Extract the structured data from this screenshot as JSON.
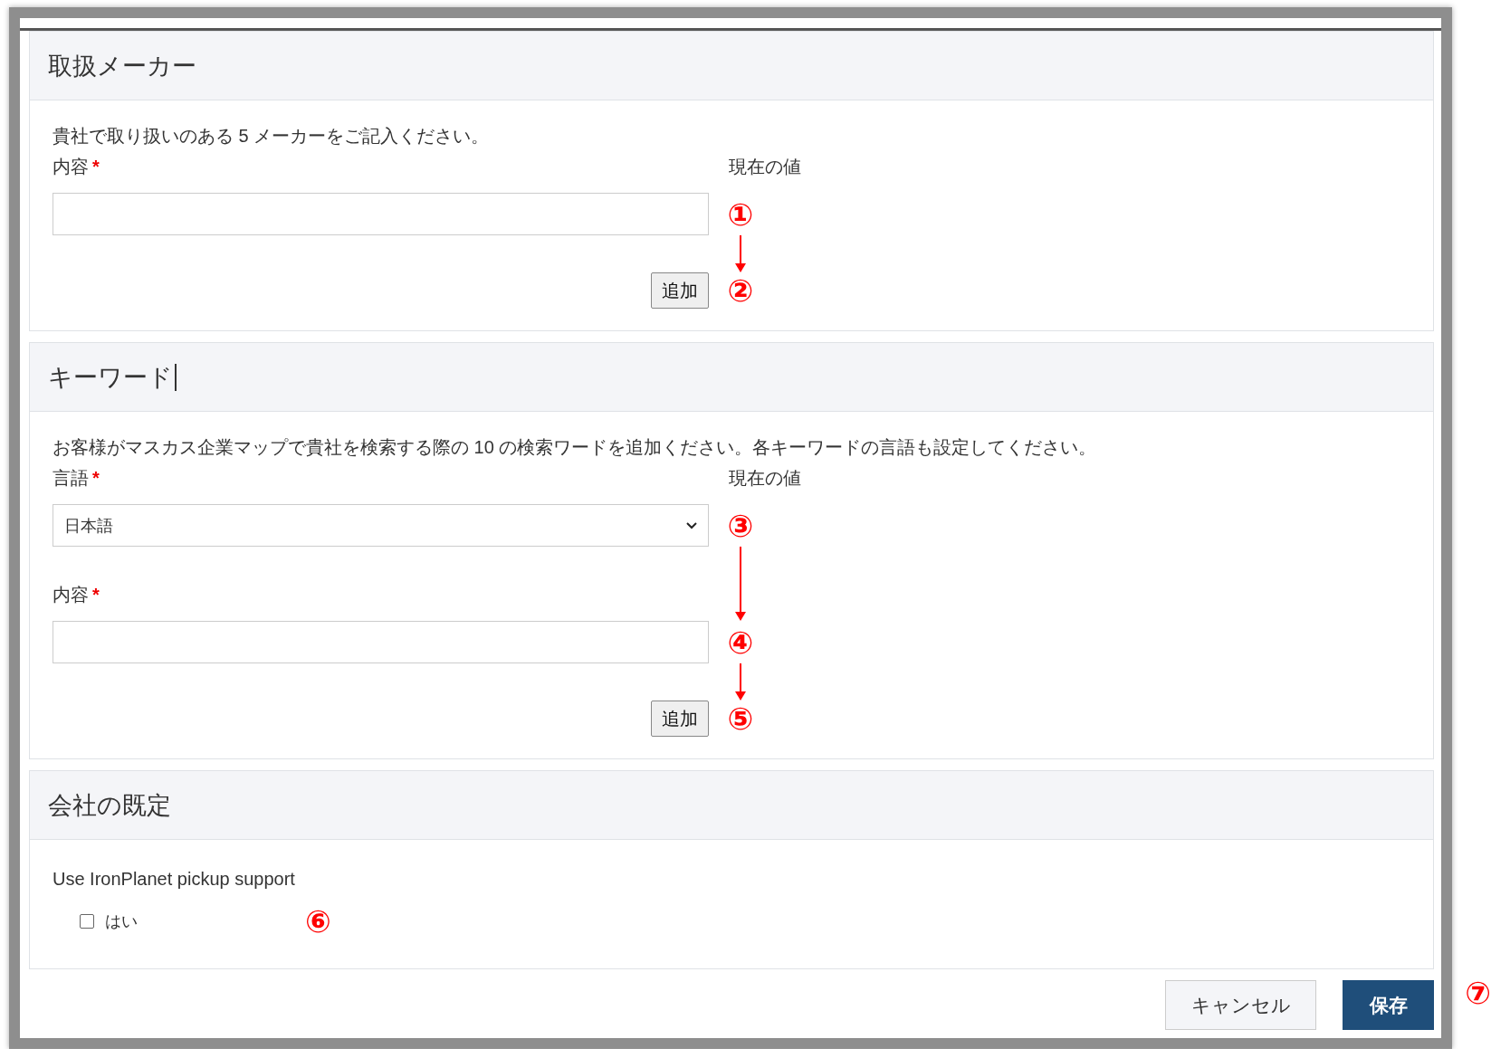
{
  "sections": [
    {
      "title": "取扱メーカー",
      "text_cursor": false,
      "description": "貴社で取り扱いのある 5 メーカーをご記入ください。",
      "current_value_label": "現在の値",
      "fields": [
        {
          "kind": "text",
          "label": "内容",
          "required_mark": "*",
          "marker": "①"
        }
      ],
      "add_button": {
        "label": "追加",
        "marker": "②",
        "arrow_before": true
      }
    },
    {
      "title": "キーワード",
      "text_cursor": true,
      "description": "お客様がマスカス企業マップで貴社を検索する際の 10 の検索ワードを追加ください。各キーワードの言語も設定してください。",
      "current_value_label": "現在の値",
      "fields": [
        {
          "kind": "select",
          "label": "言語",
          "required_mark": "*",
          "value": "日本語",
          "marker": "③"
        },
        {
          "kind": "text",
          "label": "内容",
          "required_mark": "*",
          "marker": "④",
          "arrow_before": true
        }
      ],
      "add_button": {
        "label": "追加",
        "marker": "⑤",
        "arrow_before": true
      }
    },
    {
      "title": "会社の既定",
      "text_cursor": false,
      "question": "Use IronPlanet pickup support",
      "checkbox": {
        "label": "はい",
        "checked": false,
        "marker": "⑥"
      }
    }
  ],
  "footer_buttons": [
    {
      "kind": "secondary",
      "label": "キャンセル"
    },
    {
      "kind": "primary",
      "label": "保存"
    }
  ],
  "footer_marker": "⑦"
}
